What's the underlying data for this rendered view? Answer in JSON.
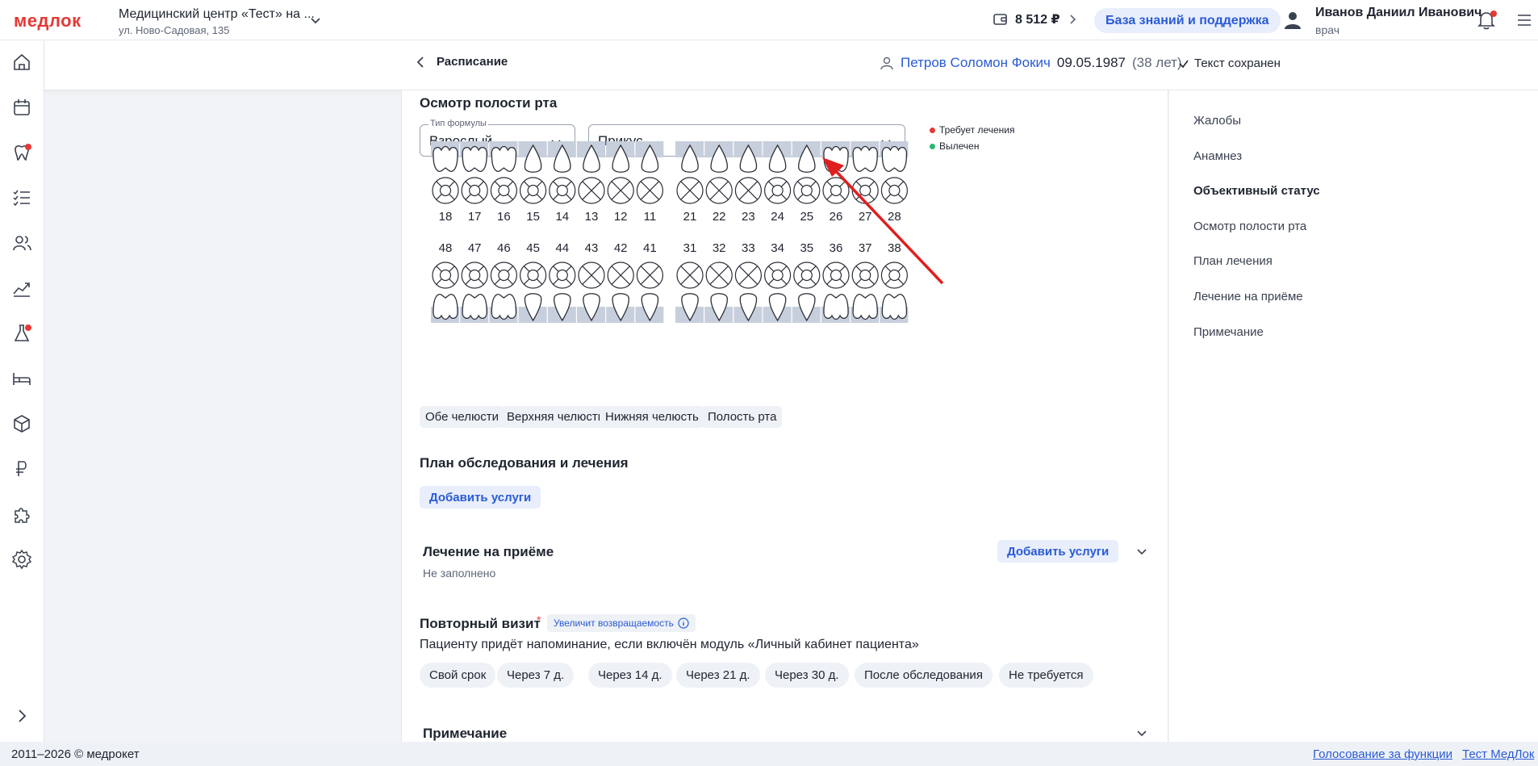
{
  "header": {
    "logo": "медлок",
    "clinic_name": "Медицинский центр «Тест» на ...",
    "clinic_address": "ул. Ново-Садовая, 135",
    "balance": "8 512 ₽",
    "knowledge_button": "База знаний и поддержка",
    "user_name": "Иванов Даниил Иванович",
    "user_role": "врач"
  },
  "subheader": {
    "back_label": "Расписание",
    "patient_name": "Петров Соломон Фокич",
    "patient_dob": "09.05.1987",
    "patient_age": "(38 лет)",
    "saved_status": "Текст сохранен"
  },
  "sidebar": {
    "icons": [
      "home-icon",
      "calendar-icon",
      "tooth-icon",
      "checklist-icon",
      "users-icon",
      "chart-icon",
      "flask-icon",
      "bed-icon",
      "box-icon",
      "ruble-icon",
      "puzzle-icon",
      "gear-icon"
    ],
    "expand_icon": "chevron-right-icon"
  },
  "oral_exam": {
    "title": "Осмотр полости рта",
    "formula_label": "Тип формулы",
    "formula_value": "Взрослый",
    "bite_value": "Прикус",
    "legend_needs_treatment": "Требует лечения",
    "legend_treated": "Вылечен",
    "legend_needs_color": "#e53935",
    "legend_treated_color": "#2bb673",
    "upper_teeth": [
      "18",
      "17",
      "16",
      "15",
      "14",
      "13",
      "12",
      "11",
      "21",
      "22",
      "23",
      "24",
      "25",
      "26",
      "27",
      "28"
    ],
    "lower_teeth": [
      "48",
      "47",
      "46",
      "45",
      "44",
      "43",
      "42",
      "41",
      "31",
      "32",
      "33",
      "34",
      "35",
      "36",
      "37",
      "38"
    ],
    "jaw_buttons": [
      "Обе челюсти",
      "Верхняя челюсть",
      "Нижняя челюсть",
      "Полость рта"
    ]
  },
  "plan": {
    "title": "План обследования и лечения",
    "add_button": "Добавить услуги"
  },
  "treatment": {
    "title": "Лечение на приёме",
    "add_button": "Добавить услуги",
    "empty_text": "Не заполнено"
  },
  "revisit": {
    "title": "Повторный визит",
    "required_mark": "*",
    "hint": "Увеличит возвращаемость",
    "description": "Пациенту придёт напоминание, если включён модуль «Личный кабинет пациента»",
    "options": [
      "Свой срок",
      "Через 7 д.",
      "Через 14 д.",
      "Через 21 д.",
      "Через 30 д.",
      "После обследования",
      "Не требуется"
    ]
  },
  "note": {
    "title": "Примечание"
  },
  "right_nav": {
    "items": [
      "Жалобы",
      "Анамнез",
      "Объективный статус",
      "Осмотр полости рта",
      "План лечения",
      "Лечение на приёме",
      "Примечание"
    ],
    "active_index": 2
  },
  "footer": {
    "copyright": "2011–2026 © медрокет",
    "vote_link": "Голосование за функции",
    "test_link": "Тест МедЛок"
  },
  "colors": {
    "brand": "#e53935",
    "accent": "#2a5bd7",
    "annotation_arrow": "#e01e1e"
  }
}
